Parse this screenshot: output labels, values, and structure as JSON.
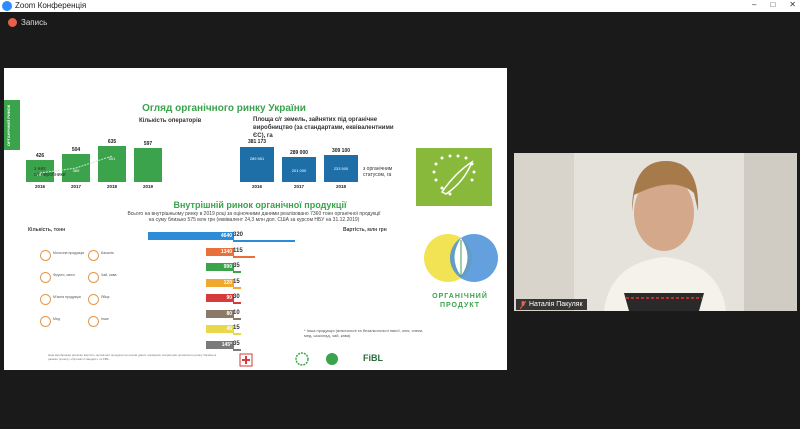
{
  "window": {
    "title": "Zoom Конференція",
    "controls": [
      "–",
      "□",
      "✕"
    ]
  },
  "recording": {
    "label": "Запись",
    "dot_color": "#e8604c"
  },
  "slide": {
    "vertical_label": "ОРГАНІЧНИЙ РИНОК",
    "title": "Огляд органічного ринку України",
    "operators": {
      "title": "Кількість операторів",
      "years": [
        "2016",
        "2017",
        "2018",
        "2019"
      ],
      "totals": [
        "426",
        "504",
        "635",
        "597"
      ],
      "inner": [
        "294",
        "369",
        "501",
        ""
      ],
      "legend": "з них\nс/г виробники"
    },
    "area": {
      "title": "Площа с/г земель, зайнятих під органічне виробництво (за стандартами, еквівалентними ЄС), га",
      "years": [
        "2016",
        "2017",
        "2018"
      ],
      "totals": [
        "381 173",
        "289 000",
        "309 100"
      ],
      "inner": [
        "289 551",
        "201 000",
        "233 500"
      ],
      "legend": "з органічним\nстатусом, га"
    },
    "internal": {
      "title": "Внутрішній ринок органічної продукції",
      "subtitle_line1": "Всього на внутрішньому ринку в 2019 році за оціночними даними реалізовано 7360 тонн органічної продукції",
      "subtitle_line2": "на суму близько 575 млн грн (еквівалент 24,3 млн дол. США за курсом НБУ на 31.12.2019)",
      "left_header": "Кількість, тонн",
      "right_header": "Вартість, млн грн",
      "tonnes": [
        "4640",
        "1340",
        "990",
        "120",
        "90",
        "80",
        "45",
        "145*"
      ],
      "value_mln": [
        "320",
        "115",
        "35",
        "15",
        "30",
        "10",
        "15",
        "35"
      ],
      "bar_colors": [
        "#2d8cd8",
        "#e8703a",
        "#3aa34c",
        "#f0a830",
        "#d63a3a",
        "#8a7a66",
        "#e8d84a",
        "#7a7a7a"
      ],
      "categories": [
        "Молочна продукція",
        "Бакалія",
        "Фрукти, овочі",
        "Чай, кава",
        "М'ясна продукція",
        "Яйця",
        "Мед",
        "Інше"
      ],
      "footnote": "* Інша продукція (алкогольні та безалкогольні напої, олія, снеки, мед, шоколад, чай, кава)"
    },
    "disclaimer": "Ціна відображає ринкову вартість органічної продукції на основі даних провідних операторів органічного ринку України в рамках проекту «Органік Стандарт» та FiBL.",
    "logos": {
      "organic_product_line1": "ОРГАНІЧНИЙ",
      "organic_product_line2": "ПРОДУКТ",
      "fibl": "FiBL"
    }
  },
  "participant": {
    "name": "Наталія Пакуляк"
  }
}
